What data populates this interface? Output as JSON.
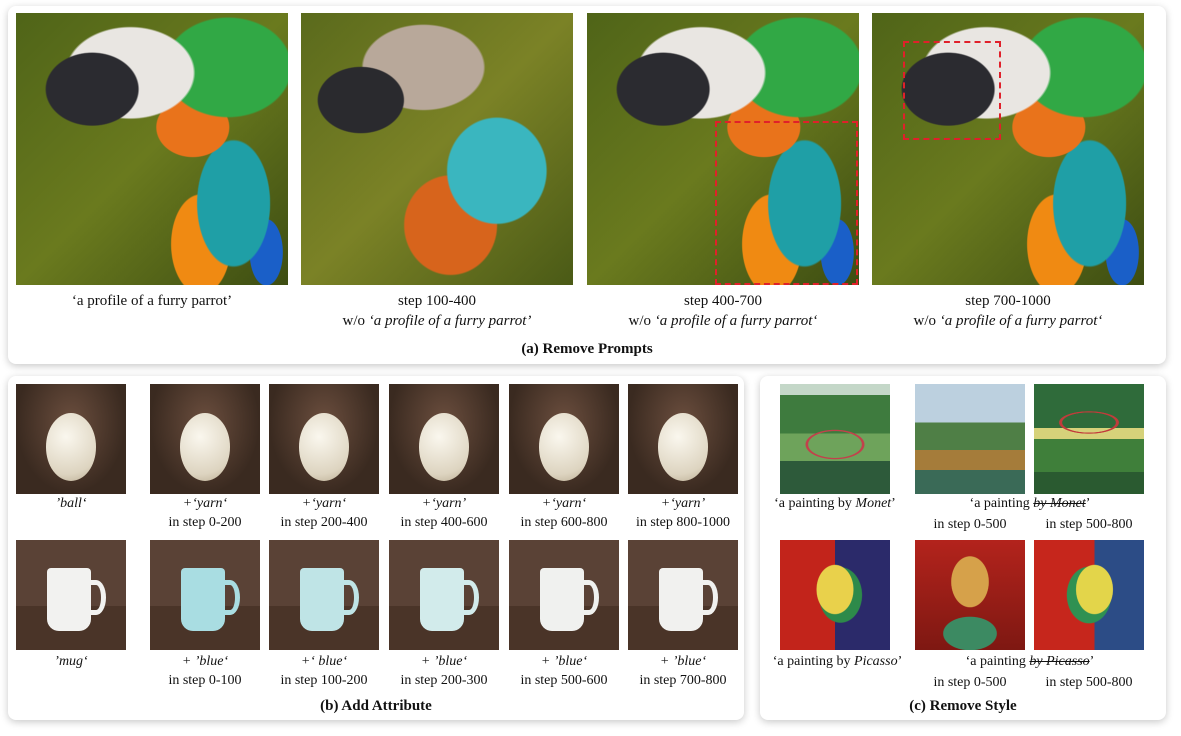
{
  "panel_a": {
    "title": "(a) Remove Prompts",
    "captions": [
      {
        "line1": "‘a profile of a furry parrot’",
        "prefix": "",
        "line2": ""
      },
      {
        "line1": "step 100-400",
        "prefix": "w/o ",
        "line2": "‘a profile of a furry parrot’"
      },
      {
        "line1": "step 400-700",
        "prefix": "w/o ",
        "line2": "‘a profile of a furry parrot‘"
      },
      {
        "line1": "step 700-1000",
        "prefix": "w/o ",
        "line2": "‘a profile of a furry parrot‘"
      }
    ]
  },
  "panel_b": {
    "title": "(b) Add Attribute",
    "ball_row": [
      {
        "line1": "’ball‘",
        "line2": ""
      },
      {
        "line1": "+‘yarn‘",
        "line2": "in step 0-200"
      },
      {
        "line1": "+‘yarn‘",
        "line2": "in step 200-400"
      },
      {
        "line1": "+‘yarn’",
        "line2": "in step 400-600"
      },
      {
        "line1": "+‘yarn‘",
        "line2": "in step 600-800"
      },
      {
        "line1": "+‘yarn’",
        "line2": "in step 800-1000"
      }
    ],
    "mug_row": [
      {
        "line1": "’mug‘",
        "line2": ""
      },
      {
        "line1": "+ ’blue‘",
        "line2": "in step 0-100"
      },
      {
        "line1": "+‘ blue‘",
        "line2": "in step 100-200"
      },
      {
        "line1": "+ ’blue‘",
        "line2": "in step 200-300"
      },
      {
        "line1": "+ ’blue‘",
        "line2": "in step 500-600"
      },
      {
        "line1": "+ ’blue‘",
        "line2": "in step 700-800"
      }
    ],
    "mug_colors": [
      "#f2f2f0",
      "#a9dde2",
      "#bfe4e6",
      "#d2ebeb",
      "#f0f1ef",
      "#f1f1ef"
    ]
  },
  "panel_c": {
    "title": "(c) Remove Style",
    "monet": {
      "cap1_pre": "‘a painting by ",
      "cap1_name": "Monet",
      "cap1_post": "’",
      "cap2_pre": "‘a painting ",
      "cap2_struck": "by Monet",
      "cap2_post": "’",
      "step_left": "in step 0-500",
      "step_right": "in step 500-800"
    },
    "picasso": {
      "cap1_pre": "‘a painting by ",
      "cap1_name": "Picasso",
      "cap1_post": "’",
      "cap2_pre": "‘a painting ",
      "cap2_struck": "by Picasso",
      "cap2_post": "’",
      "step_left": "in step 0-500",
      "step_right": "in step 500-800"
    }
  }
}
